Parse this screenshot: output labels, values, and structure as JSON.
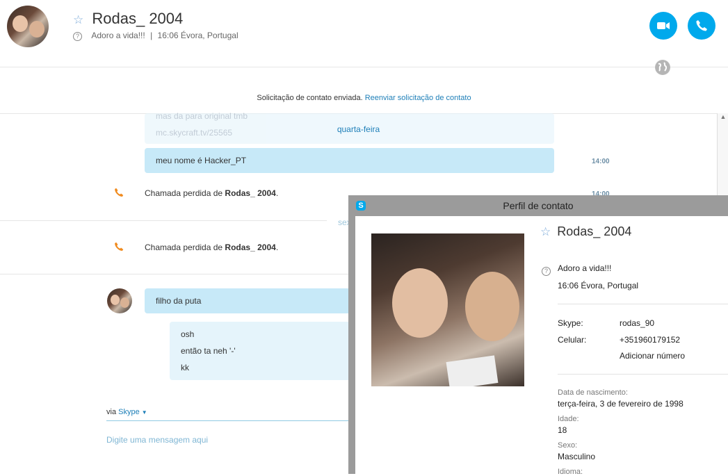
{
  "header": {
    "name": "Rodas_ 2004",
    "mood": "Adoro a vida!!!",
    "separator": "|",
    "time_location": "16:06 Évora, Portugal"
  },
  "notice": {
    "text": "Solicitação de contato enviada.",
    "link": "Reenviar solicitação de contato"
  },
  "chat": {
    "faded_line1": "mas da para original tmb",
    "faded_line2": "mc.skycraft.tv/25565",
    "day_label_1": "quarta-feira",
    "msg1": "meu nome é Hacker_PT",
    "time1": "14:00",
    "missed_prefix": "Chamada perdida de",
    "missed_name": "Rodas_ 2004",
    "missed_suffix": ".",
    "time2": "14:00",
    "day_label_2": "sex",
    "msg2": "filho da puta",
    "reply_lines": [
      "osh",
      "então ta neh '-'",
      "kk"
    ]
  },
  "composer": {
    "via": "via",
    "service": "Skype",
    "placeholder": "Digite uma mensagem aqui"
  },
  "profile": {
    "window_title": "Perfil de contato",
    "name": "Rodas_ 2004",
    "mood": "Adoro a vida!!!",
    "time_location": "16:06 Évora, Portugal",
    "skype_label": "Skype:",
    "skype_value": "rodas_90",
    "phone_label": "Celular:",
    "phone_value": "+351960179152",
    "add_number": "Adicionar número",
    "birth_label": "Data de nascimento:",
    "birth_value": "terça-feira, 3 de fevereiro de 1998",
    "age_label": "Idade:",
    "age_value": "18",
    "sex_label": "Sexo:",
    "sex_value": "Masculino",
    "lang_label": "Idioma:"
  },
  "colors": {
    "accent": "#00a9ec",
    "bubble": "#c7e9f8",
    "link": "#1e7fb8",
    "missed_call": "#f08b1f"
  },
  "icons": [
    "star-icon",
    "question-icon",
    "video-icon",
    "phone-icon",
    "globe-icon",
    "missed-call-icon",
    "skype-logo-icon",
    "chevron-down-icon"
  ]
}
